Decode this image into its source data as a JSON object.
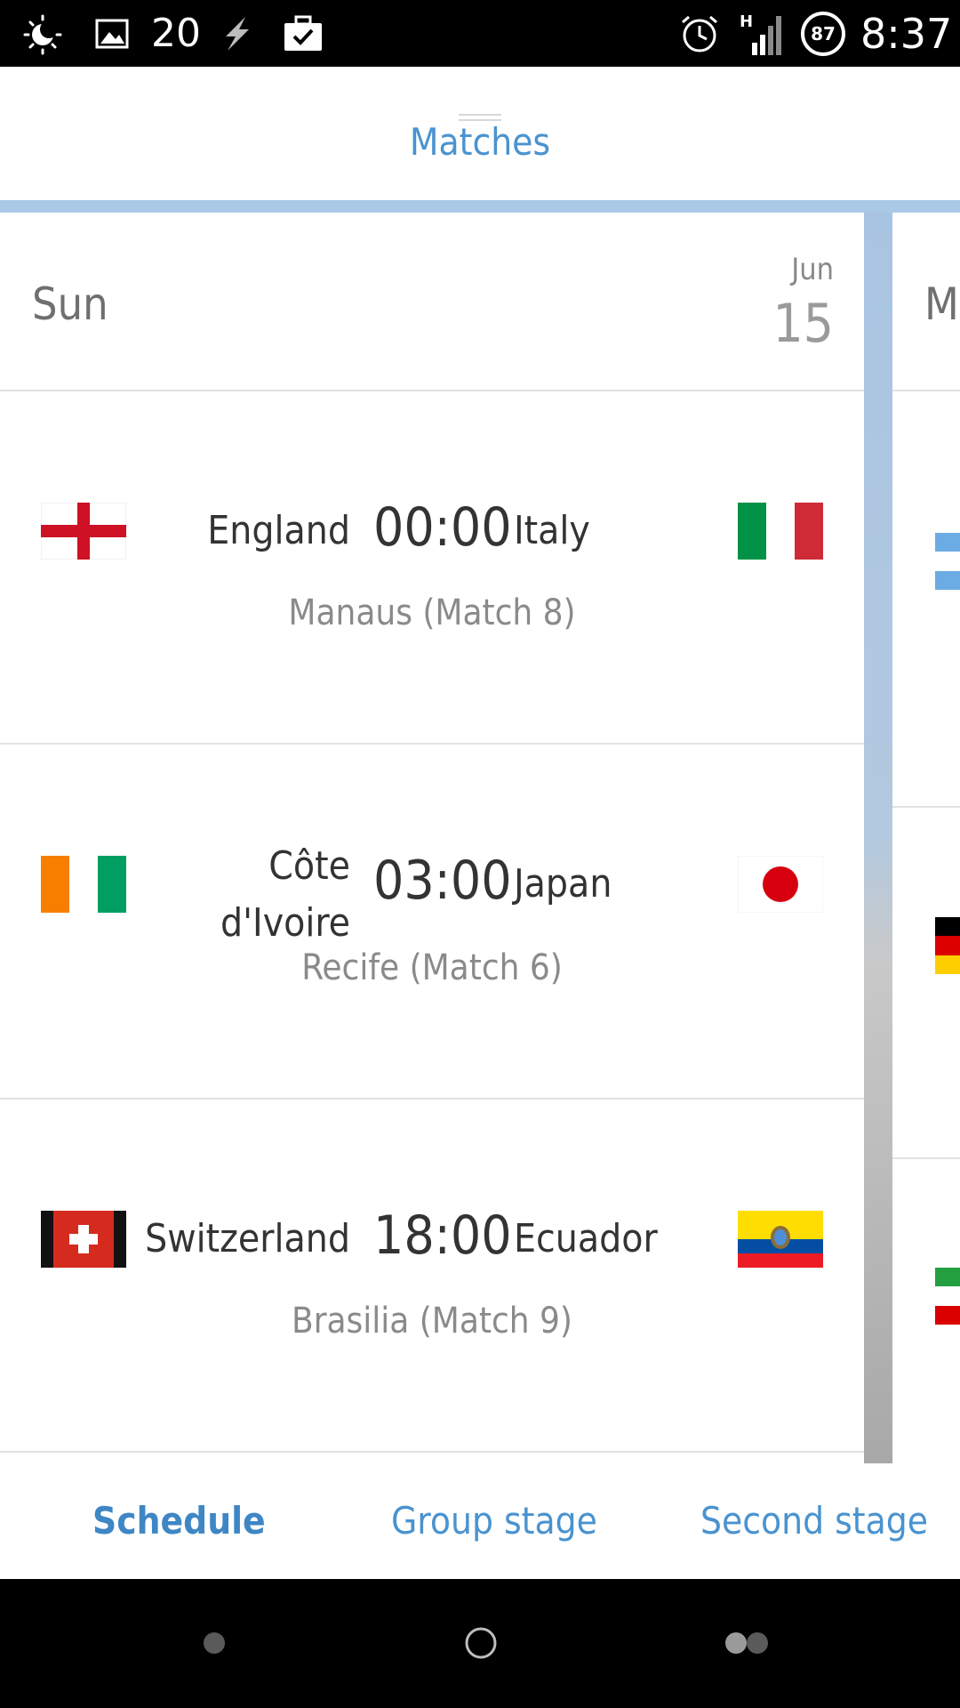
{
  "status_bar": {
    "notification_count": "20",
    "battery_level": "87",
    "time": "8:37",
    "network_type": "H",
    "icons": [
      "weather-icon",
      "image-icon",
      "lightning-icon",
      "briefcase-icon",
      "alarm-icon",
      "signal-icon",
      "battery-icon"
    ]
  },
  "header": {
    "title": "Matches"
  },
  "day": {
    "weekday": "Sun",
    "month": "Jun",
    "date": "15",
    "matches": [
      {
        "home": "England",
        "time": "00:00",
        "away": "Italy",
        "venue": "Manaus (Match 8)",
        "home_flag": "england-flag-icon",
        "away_flag": "italy-flag-icon"
      },
      {
        "home": "Côte d'Ivoire",
        "home_line1": "Côte",
        "home_line2": "d'Ivoire",
        "time": "03:00",
        "away": "Japan",
        "venue": "Recife (Match 6)",
        "home_flag": "cote-divoire-flag-icon",
        "away_flag": "japan-flag-icon"
      },
      {
        "home": "Switzerland",
        "time": "18:00",
        "away": "Ecuador",
        "venue": "Brasilia (Match 9)",
        "home_flag": "switzerland-flag-icon",
        "away_flag": "ecuador-flag-icon"
      }
    ]
  },
  "next_day": {
    "weekday_partial": "Mo"
  },
  "tabs": [
    {
      "label": "Schedule",
      "active": true
    },
    {
      "label": "Group stage",
      "active": false
    },
    {
      "label": "Second stage",
      "active": false
    }
  ],
  "colors": {
    "accent": "#4a93cf",
    "header_line": "#a9c9e6",
    "text_primary": "#333333",
    "text_secondary": "#8a8a8a"
  },
  "nav": {
    "buttons": [
      "back-button",
      "home-button",
      "recents-button"
    ]
  }
}
